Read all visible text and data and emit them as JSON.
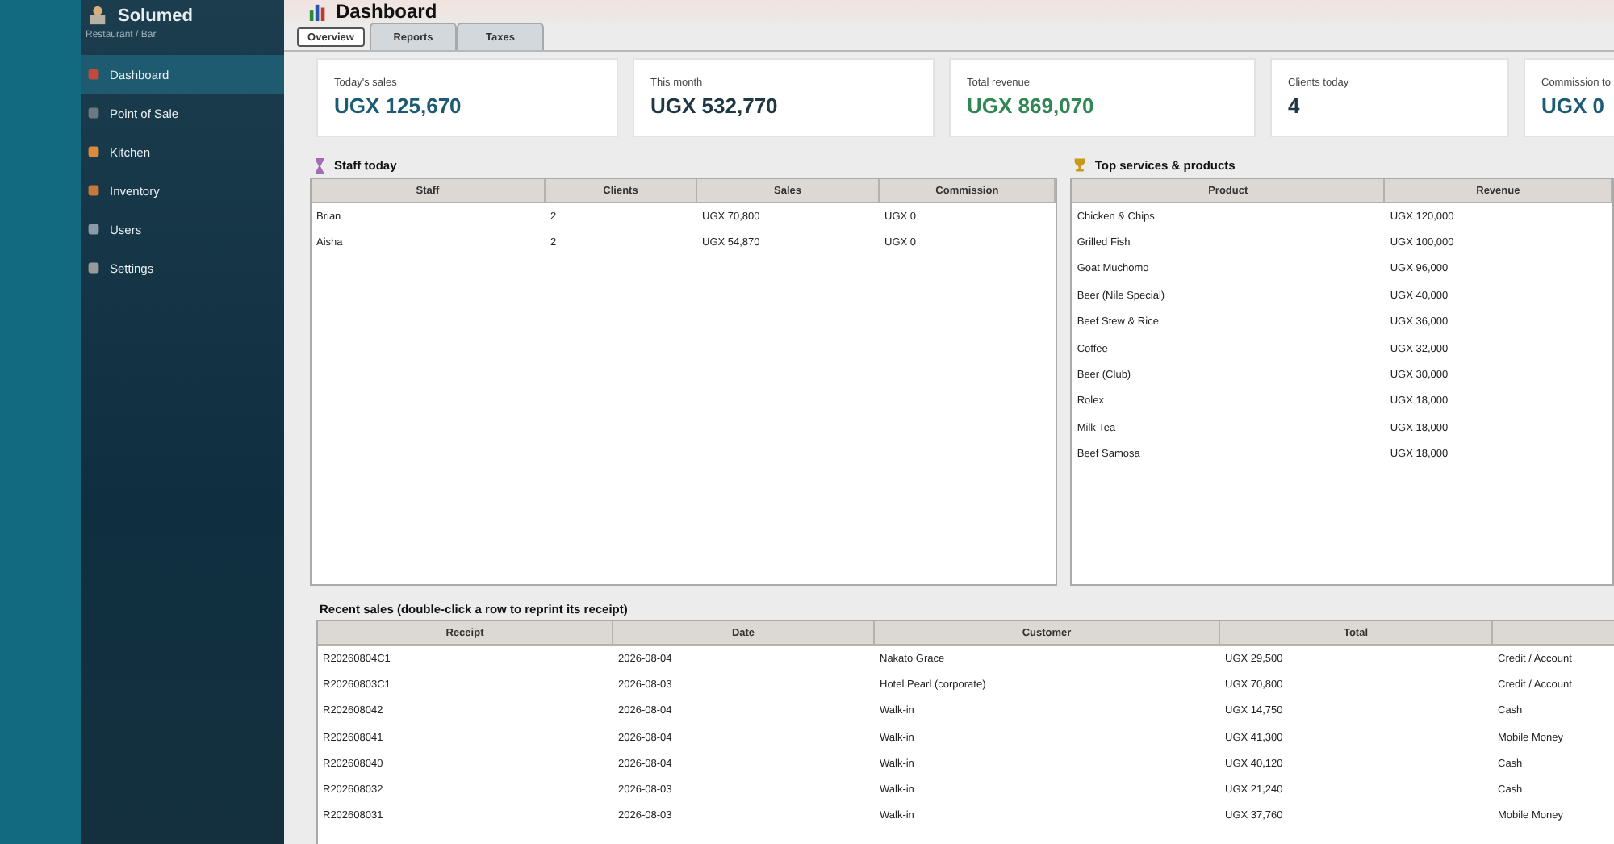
{
  "app": {
    "name": "Solumed",
    "subtitle": "Restaurant / Bar"
  },
  "sidebar": {
    "items": [
      {
        "label": "Dashboard",
        "selected": true
      },
      {
        "label": "Point of Sale",
        "selected": false
      },
      {
        "label": "Kitchen",
        "selected": false
      },
      {
        "label": "Inventory",
        "selected": false
      },
      {
        "label": "Users",
        "selected": false
      },
      {
        "label": "Settings",
        "selected": false
      }
    ]
  },
  "page_title": "Dashboard",
  "tabs": [
    {
      "label": "Overview",
      "selected": true
    },
    {
      "label": "Reports",
      "selected": false
    },
    {
      "label": "Taxes",
      "selected": false
    }
  ],
  "metrics": [
    {
      "label": "Today's sales",
      "value": "UGX 125,670",
      "color": "#1d5b74"
    },
    {
      "label": "This month",
      "value": "UGX 532,770",
      "color": "#1f3644"
    },
    {
      "label": "Total revenue",
      "value": "UGX 869,070",
      "color": "#2f8752"
    },
    {
      "label": "Clients today",
      "value": "4",
      "color": "#1f3644"
    },
    {
      "label": "Commission to",
      "value": "UGX 0",
      "color": "#1d5b74"
    }
  ],
  "staff_today": {
    "title": "Staff today",
    "columns": [
      "Staff",
      "Clients",
      "Sales",
      "Commission"
    ],
    "rows": [
      [
        "Brian",
        "2",
        "UGX 70,800",
        "UGX 0"
      ],
      [
        "Aisha",
        "2",
        "UGX 54,870",
        "UGX 0"
      ]
    ]
  },
  "top_products": {
    "title": "Top services & products",
    "columns": [
      "Product",
      "Revenue"
    ],
    "rows": [
      [
        "Chicken & Chips",
        "UGX 120,000"
      ],
      [
        "Grilled Fish",
        "UGX 100,000"
      ],
      [
        "Goat Muchomo",
        "UGX 96,000"
      ],
      [
        "Beer (Nile Special)",
        "UGX 40,000"
      ],
      [
        "Beef Stew & Rice",
        "UGX 36,000"
      ],
      [
        "Coffee",
        "UGX 32,000"
      ],
      [
        "Beer (Club)",
        "UGX 30,000"
      ],
      [
        "Rolex",
        "UGX 18,000"
      ],
      [
        "Milk Tea",
        "UGX 18,000"
      ],
      [
        "Beef Samosa",
        "UGX 18,000"
      ]
    ]
  },
  "recent_sales": {
    "title": "Recent sales  (double-click a row to reprint its receipt)",
    "columns": [
      "Receipt",
      "Date",
      "Customer",
      "Total"
    ],
    "rows": [
      [
        "R20260804C1",
        "2026-08-04",
        "Nakato Grace",
        "UGX 29,500",
        "Credit / Account"
      ],
      [
        "R20260803C1",
        "2026-08-03",
        "Hotel Pearl (corporate)",
        "UGX 70,800",
        "Credit / Account"
      ],
      [
        "R202608042",
        "2026-08-04",
        "Walk-in",
        "UGX 14,750",
        "Cash"
      ],
      [
        "R202608041",
        "2026-08-04",
        "Walk-in",
        "UGX 41,300",
        "Mobile Money"
      ],
      [
        "R202608040",
        "2026-08-04",
        "Walk-in",
        "UGX 40,120",
        "Cash"
      ],
      [
        "R202608032",
        "2026-08-03",
        "Walk-in",
        "UGX 21,240",
        "Cash"
      ],
      [
        "R202608031",
        "2026-08-03",
        "Walk-in",
        "UGX 37,760",
        "Mobile Money"
      ]
    ]
  }
}
